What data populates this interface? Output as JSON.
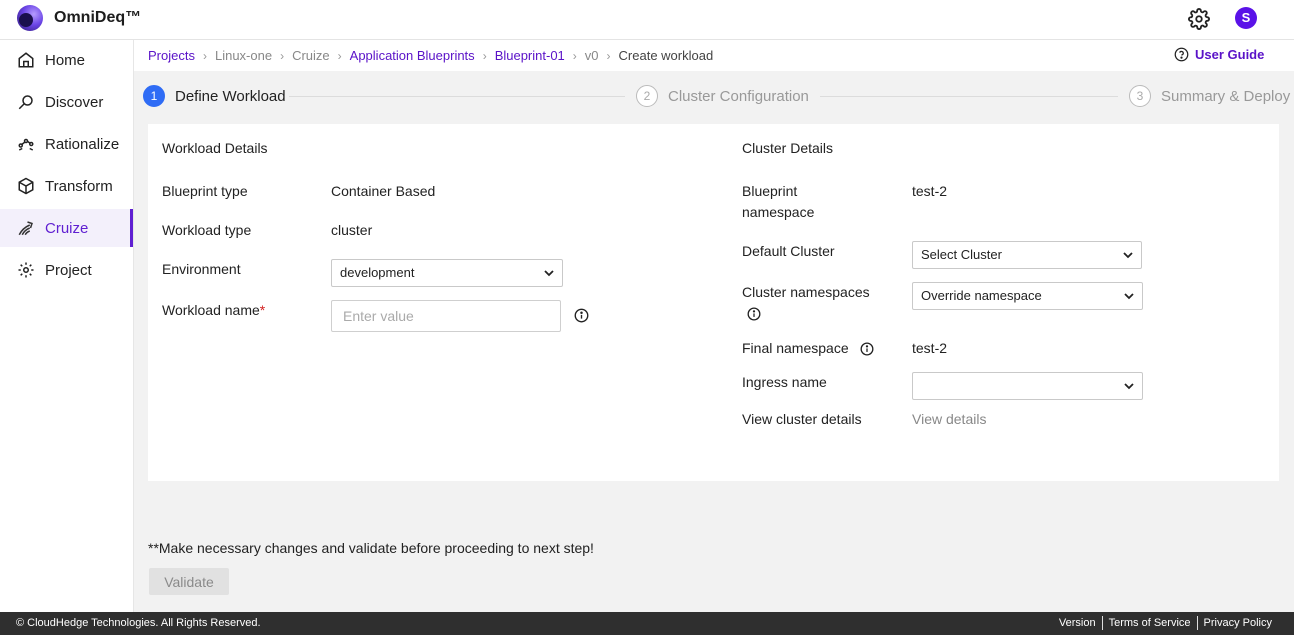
{
  "header": {
    "brand": "OmniDeq™",
    "avatar_initial": "S"
  },
  "sidebar": {
    "items": [
      {
        "label": "Home",
        "icon": "home-icon"
      },
      {
        "label": "Discover",
        "icon": "discover-icon"
      },
      {
        "label": "Rationalize",
        "icon": "rationalize-icon"
      },
      {
        "label": "Transform",
        "icon": "cube-icon"
      },
      {
        "label": "Cruize",
        "icon": "cruize-icon",
        "active": true
      },
      {
        "label": "Project",
        "icon": "gear-icon"
      }
    ]
  },
  "breadcrumb": {
    "items": [
      "Projects",
      "Linux-one",
      "Cruize",
      "Application Blueprints",
      "Blueprint-01",
      "v0",
      "Create workload"
    ]
  },
  "user_guide": "User Guide",
  "stepper": {
    "steps": [
      {
        "num": "1",
        "label": "Define Workload"
      },
      {
        "num": "2",
        "label": "Cluster Configuration"
      },
      {
        "num": "3",
        "label": "Summary & Deploy"
      }
    ]
  },
  "workload": {
    "title": "Workload Details",
    "blueprint_type_label": "Blueprint type",
    "blueprint_type_value": "Container Based",
    "workload_type_label": "Workload type",
    "workload_type_value": "cluster",
    "environment_label": "Environment",
    "environment_value": "development",
    "workload_name_label": "Workload name",
    "workload_name_required": "*",
    "workload_name_placeholder": "Enter value"
  },
  "cluster": {
    "title": "Cluster Details",
    "blueprint_ns_label": "Blueprint namespace",
    "blueprint_ns_value": "test-2",
    "default_cluster_label": "Default Cluster",
    "default_cluster_value": "Select Cluster",
    "cluster_ns_label": "Cluster namespaces",
    "cluster_ns_value": "Override namespace",
    "final_ns_label": "Final namespace",
    "final_ns_value": "test-2",
    "ingress_label": "Ingress name",
    "ingress_value": "",
    "view_details_label": "View cluster details",
    "view_details_link": "View details"
  },
  "note": "**Make necessary changes and validate before proceeding to next step!",
  "validate_label": "Validate",
  "footer": {
    "copyright": "© CloudHedge Technologies. All Rights Reserved.",
    "links": [
      "Version",
      "Terms of Service",
      "Privacy Policy"
    ]
  }
}
